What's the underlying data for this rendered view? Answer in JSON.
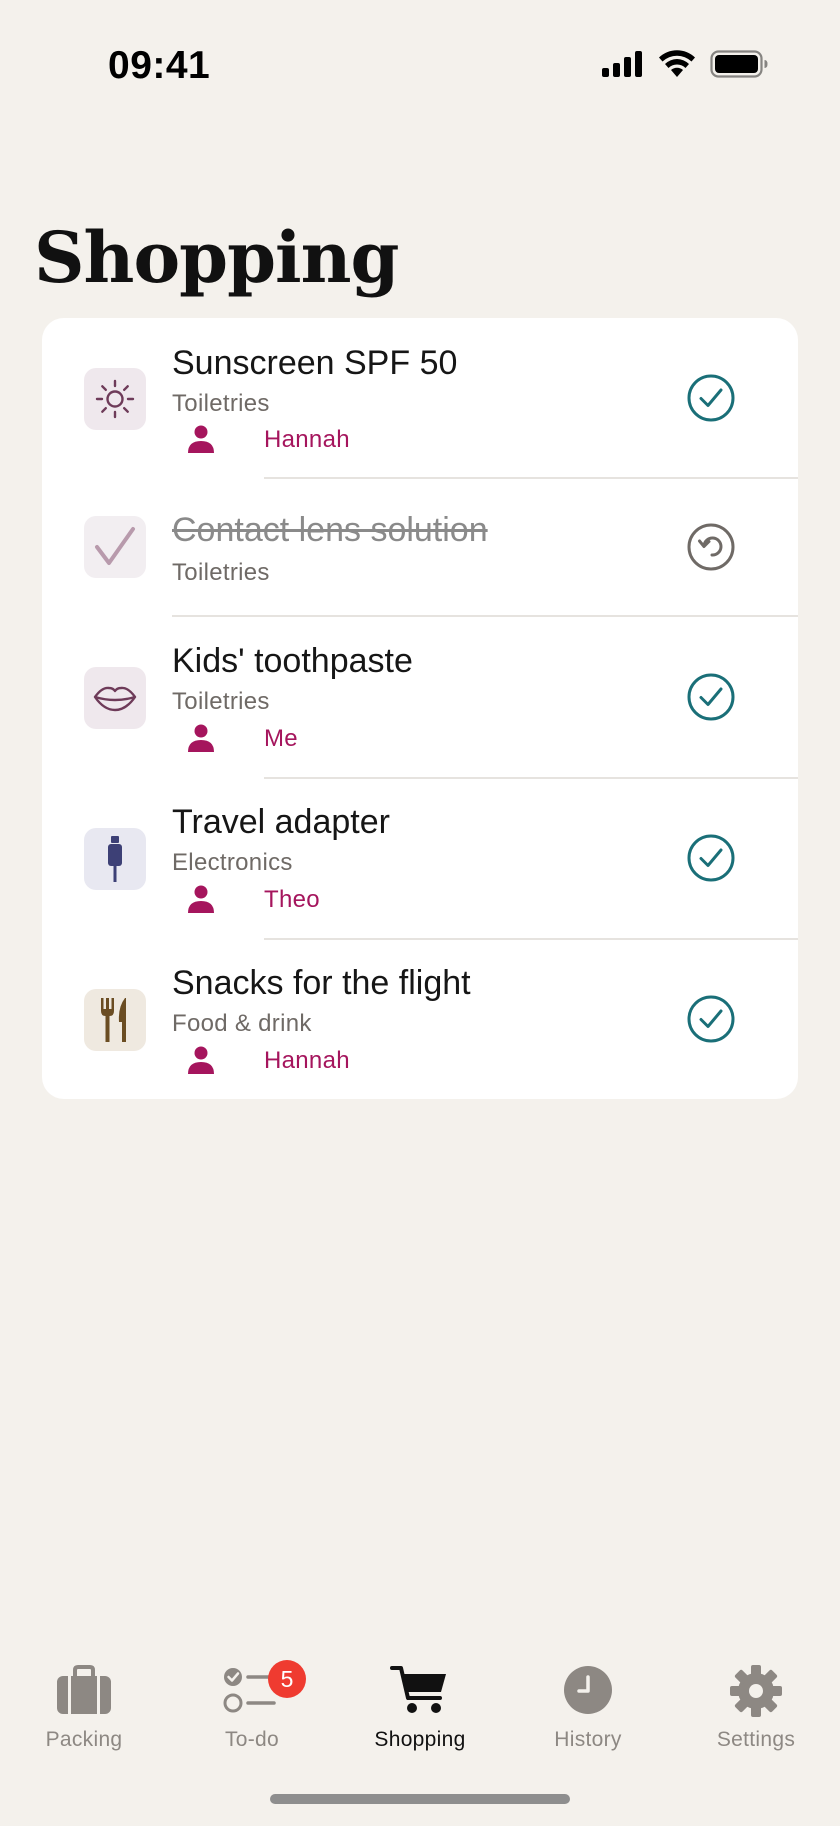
{
  "status": {
    "time": "09:41",
    "icons": [
      "cellular-signal-icon",
      "wifi-icon",
      "battery-icon"
    ]
  },
  "page": {
    "title": "Shopping"
  },
  "items": [
    {
      "title": "Sunscreen SPF 50",
      "category": "Toiletries",
      "person": "Hannah",
      "icon": "sun-icon",
      "done": false,
      "action": "check-circle-icon"
    },
    {
      "title": "Contact lens solution",
      "category": "Toiletries",
      "person": "",
      "icon": "checkmark-icon",
      "done": true,
      "action": "undo-circle-icon"
    },
    {
      "title": "Kids' toothpaste",
      "category": "Toiletries",
      "person": "Me",
      "icon": "lips-icon",
      "done": false,
      "action": "check-circle-icon"
    },
    {
      "title": "Travel adapter",
      "category": "Electronics",
      "person": "Theo",
      "icon": "plug-icon",
      "done": false,
      "action": "check-circle-icon"
    },
    {
      "title": "Snacks for the flight",
      "category": "Food & drink",
      "person": "Hannah",
      "icon": "fork-knife-icon",
      "done": false,
      "action": "check-circle-icon"
    }
  ],
  "tabs": [
    {
      "label": "Packing",
      "icon": "suitcase-icon",
      "active": false
    },
    {
      "label": "To-do",
      "icon": "checklist-icon",
      "active": false,
      "badge": "5"
    },
    {
      "label": "Shopping",
      "icon": "cart-icon",
      "active": true
    },
    {
      "label": "History",
      "icon": "clock-icon",
      "active": false
    },
    {
      "label": "Settings",
      "icon": "gear-icon",
      "active": false
    }
  ],
  "colors": {
    "background": "#f4f1ec",
    "accent_teal": "#1a6f78",
    "person_magenta": "#a5155d",
    "badge_red": "#ef3b30"
  }
}
